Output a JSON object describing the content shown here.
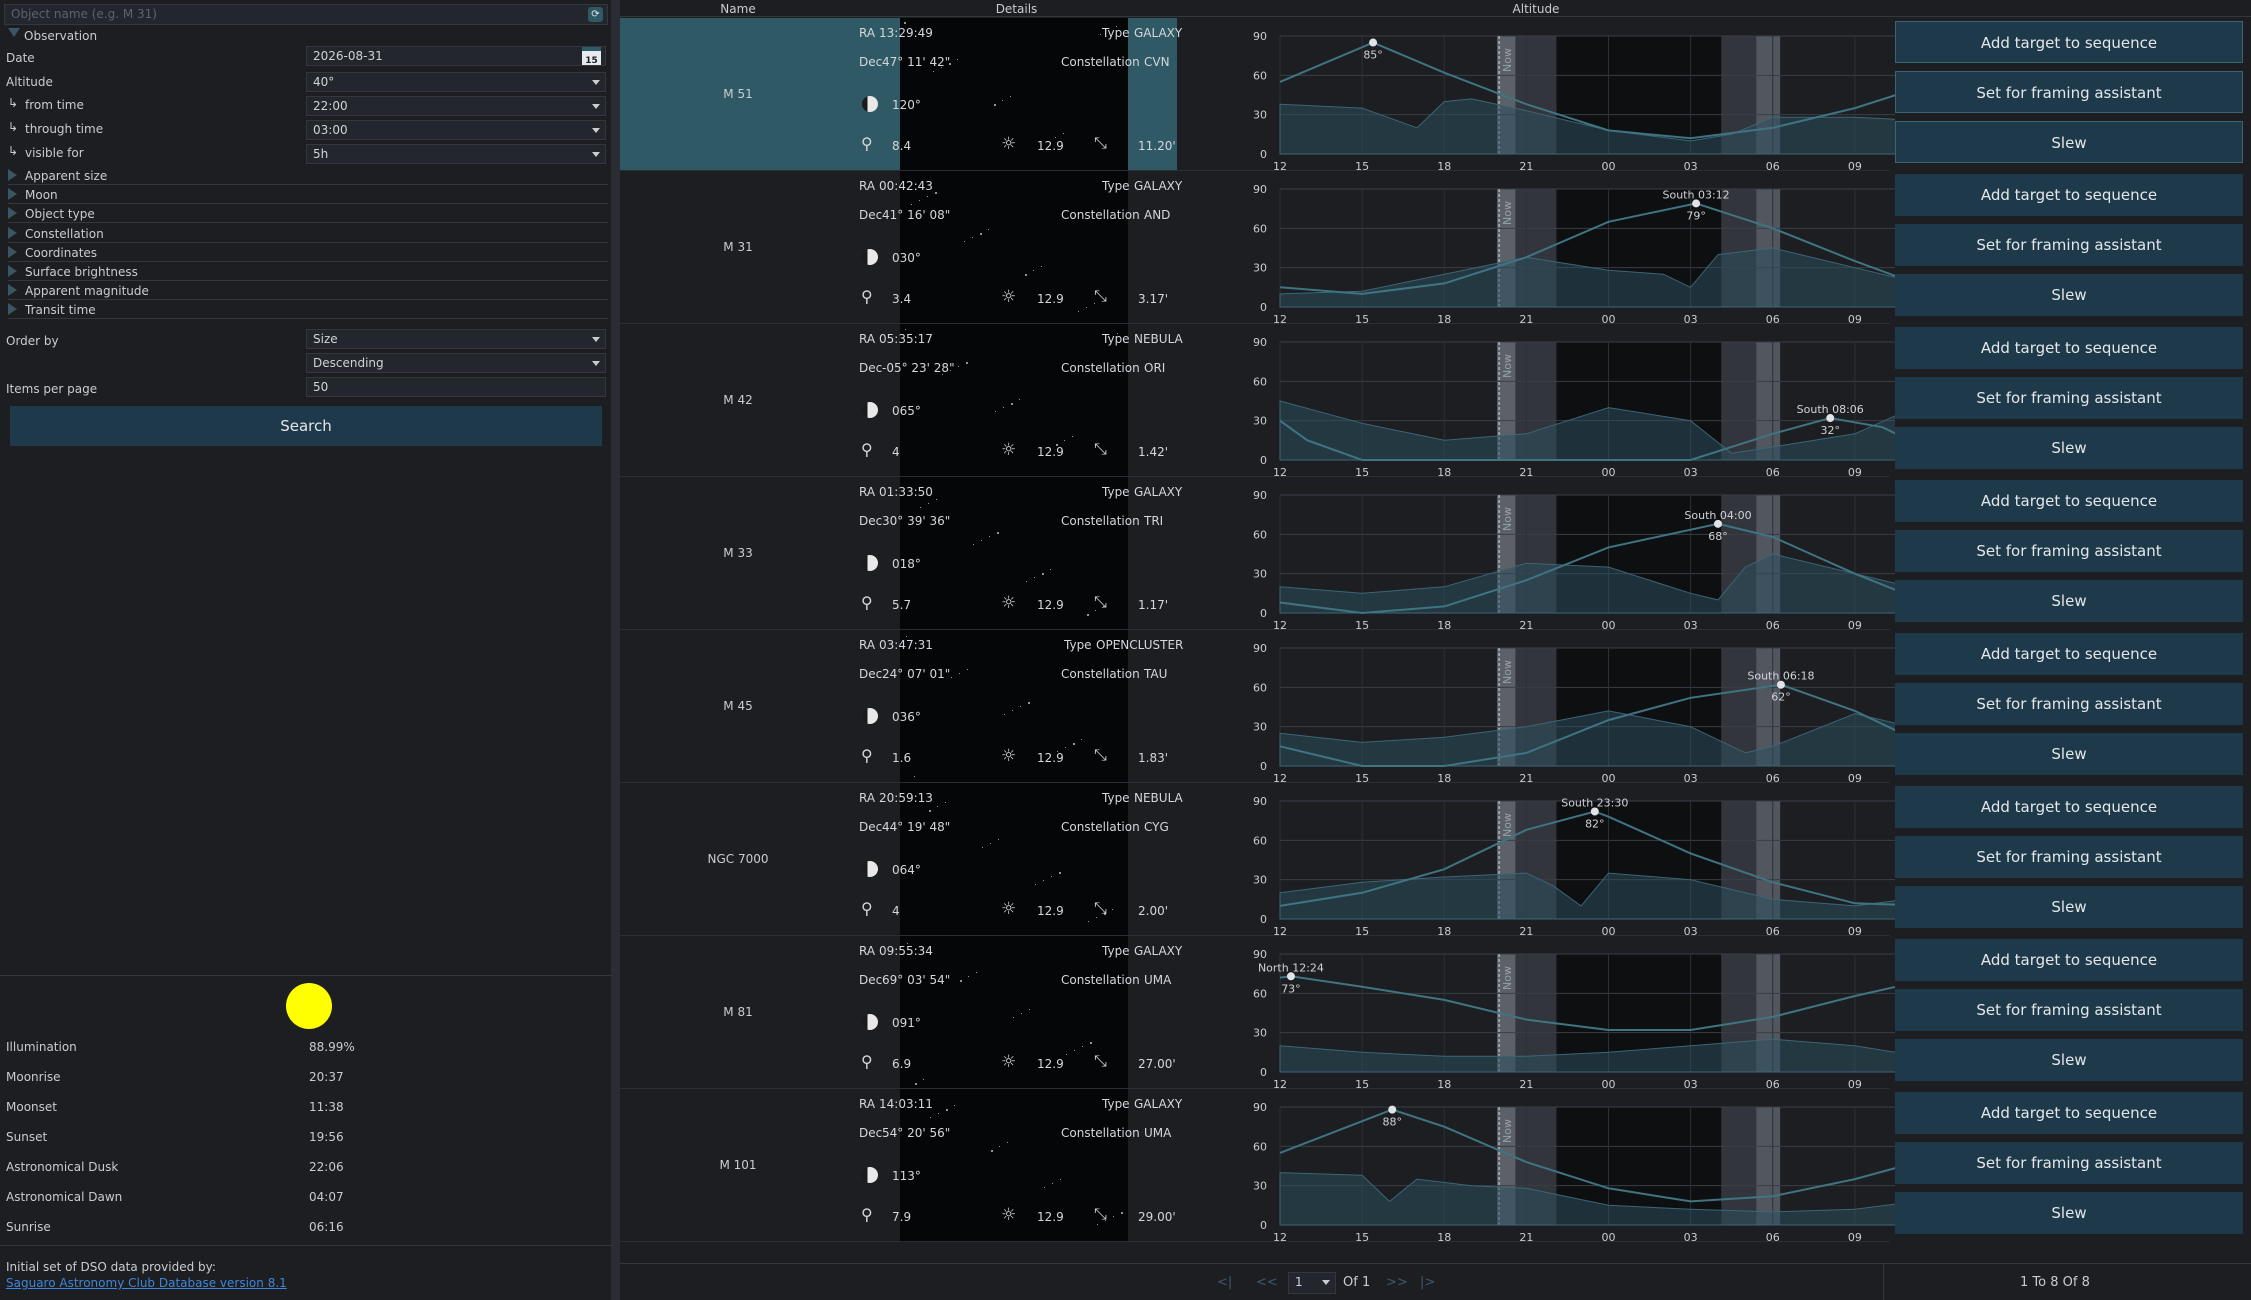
{
  "filters": {
    "object_name_placeholder": "Object name (e.g. M 31)",
    "observation_label": "Observation",
    "date_label": "Date",
    "date_value": "2026-08-31",
    "calendar_day": "15",
    "altitude_label": "Altitude",
    "altitude_value": "40°",
    "from_time_label": "from time",
    "from_time_value": "22:00",
    "through_time_label": "through time",
    "through_time_value": "03:00",
    "visible_for_label": "visible for",
    "visible_for_value": "5h",
    "expanders": [
      "Apparent size",
      "Moon",
      "Object type",
      "Constellation",
      "Coordinates",
      "Surface brightness",
      "Apparent magnitude",
      "Transit time"
    ],
    "order_by_label": "Order by",
    "order_by_value": "Size",
    "order_dir_value": "Descending",
    "items_per_page_label": "Items per page",
    "items_per_page_value": "50",
    "search_label": "Search"
  },
  "moon": {
    "illumination_label": "Illumination",
    "illumination_value": "88.99%",
    "moonrise_label": "Moonrise",
    "moonrise_value": "20:37",
    "moonset_label": "Moonset",
    "moonset_value": "11:38",
    "sunset_label": "Sunset",
    "sunset_value": "19:56",
    "dusk_label": "Astronomical Dusk",
    "dusk_value": "22:06",
    "dawn_label": "Astronomical Dawn",
    "dawn_value": "04:07",
    "sunrise_label": "Sunrise",
    "sunrise_value": "06:16",
    "moon_color": "#ffff00"
  },
  "credit": {
    "line1": "Initial set of DSO data provided by:",
    "link": "Saguaro Astronomy Club Database version 8.1"
  },
  "columns": {
    "name": "Name",
    "details": "Details",
    "altitude": "Altitude"
  },
  "chart_axes": {
    "y_ticks": [
      "90",
      "60",
      "30",
      "0"
    ],
    "x_ticks": [
      "12",
      "15",
      "18",
      "21",
      "00",
      "03",
      "06",
      "09",
      "12"
    ],
    "now_label": "Now"
  },
  "detail_labels": {
    "ra": "RA",
    "dec": "Dec",
    "type": "Type",
    "constellation": "Constellation",
    "sb": "12.9"
  },
  "actions": {
    "add": "Add target to sequence",
    "framing": "Set for framing assistant",
    "slew": "Slew"
  },
  "targets": [
    {
      "name": "M 51",
      "ra": "13:29:49",
      "dec": "47° 11' 42\"",
      "type": "GALAXY",
      "constellation": "CVN",
      "moon_dist": "120°",
      "magnitude": "8.4",
      "size": "11.20'",
      "transit_label": "",
      "transit_alt": "85°",
      "peak_x": 15.4,
      "peak_alt": 85,
      "selected": true,
      "curve": [
        [
          12,
          55
        ],
        [
          15.4,
          85
        ],
        [
          18,
          62
        ],
        [
          21,
          38
        ],
        [
          0,
          18
        ],
        [
          3,
          12
        ],
        [
          6,
          20
        ],
        [
          9,
          35
        ],
        [
          12,
          55
        ]
      ],
      "moon_curve": [
        [
          12,
          38
        ],
        [
          15,
          35
        ],
        [
          17,
          20
        ],
        [
          18,
          40
        ],
        [
          19,
          42
        ],
        [
          21,
          33
        ],
        [
          0,
          18
        ],
        [
          3,
          10
        ],
        [
          4.5,
          15
        ],
        [
          6,
          28
        ],
        [
          9,
          28
        ],
        [
          12,
          25
        ]
      ]
    },
    {
      "name": "M 31",
      "ra": "00:42:43",
      "dec": "41° 16' 08\"",
      "type": "GALAXY",
      "constellation": "AND",
      "moon_dist": "030°",
      "magnitude": "3.4",
      "size": "3.17'",
      "transit_label": "South 03:12",
      "transit_alt": "79°",
      "peak_x": 3.2,
      "peak_alt": 79,
      "selected": false,
      "curve": [
        [
          12,
          15
        ],
        [
          15,
          10
        ],
        [
          18,
          18
        ],
        [
          21,
          38
        ],
        [
          0,
          65
        ],
        [
          3.2,
          79
        ],
        [
          6,
          60
        ],
        [
          9,
          35
        ],
        [
          12,
          12
        ]
      ],
      "moon_curve": [
        [
          12,
          10
        ],
        [
          15,
          12
        ],
        [
          18,
          25
        ],
        [
          21,
          38
        ],
        [
          0,
          28
        ],
        [
          2,
          25
        ],
        [
          3,
          15
        ],
        [
          4,
          40
        ],
        [
          6,
          45
        ],
        [
          9,
          30
        ],
        [
          12,
          15
        ]
      ]
    },
    {
      "name": "M 42",
      "ra": "05:35:17",
      "dec": "-05° 23' 28\"",
      "type": "NEBULA",
      "constellation": "ORI",
      "moon_dist": "065°",
      "magnitude": "4",
      "size": "1.42'",
      "transit_label": "South 08:06",
      "transit_alt": "32°",
      "peak_x": 8.1,
      "peak_alt": 32,
      "selected": false,
      "curve": [
        [
          12,
          30
        ],
        [
          13,
          15
        ],
        [
          15,
          0
        ],
        [
          18,
          0
        ],
        [
          21,
          0
        ],
        [
          0,
          0
        ],
        [
          3,
          0
        ],
        [
          6,
          20
        ],
        [
          8.1,
          32
        ],
        [
          10,
          25
        ],
        [
          12,
          5
        ]
      ],
      "moon_curve": [
        [
          12,
          45
        ],
        [
          15,
          28
        ],
        [
          18,
          15
        ],
        [
          21,
          20
        ],
        [
          0,
          40
        ],
        [
          3,
          30
        ],
        [
          4.5,
          5
        ],
        [
          6,
          10
        ],
        [
          9,
          20
        ],
        [
          12,
          48
        ]
      ]
    },
    {
      "name": "M 33",
      "ra": "01:33:50",
      "dec": "30° 39' 36\"",
      "type": "GALAXY",
      "constellation": "TRI",
      "moon_dist": "018°",
      "magnitude": "5.7",
      "size": "1.17'",
      "transit_label": "South 04:00",
      "transit_alt": "68°",
      "peak_x": 4.0,
      "peak_alt": 68,
      "selected": false,
      "curve": [
        [
          12,
          8
        ],
        [
          15,
          0
        ],
        [
          18,
          5
        ],
        [
          21,
          25
        ],
        [
          0,
          50
        ],
        [
          4,
          68
        ],
        [
          6,
          58
        ],
        [
          9,
          30
        ],
        [
          12,
          5
        ]
      ],
      "moon_curve": [
        [
          12,
          20
        ],
        [
          15,
          15
        ],
        [
          18,
          20
        ],
        [
          21,
          38
        ],
        [
          0,
          35
        ],
        [
          3,
          15
        ],
        [
          4,
          10
        ],
        [
          5,
          35
        ],
        [
          6,
          45
        ],
        [
          9,
          30
        ],
        [
          12,
          15
        ]
      ]
    },
    {
      "name": "M 45",
      "ra": "03:47:31",
      "dec": "24° 07' 01\"",
      "type": "OPENCLUSTER",
      "constellation": "TAU",
      "moon_dist": "036°",
      "magnitude": "1.6",
      "size": "1.83'",
      "transit_label": "South 06:18",
      "transit_alt": "62°",
      "peak_x": 6.3,
      "peak_alt": 62,
      "selected": false,
      "curve": [
        [
          12,
          15
        ],
        [
          15,
          0
        ],
        [
          18,
          0
        ],
        [
          21,
          10
        ],
        [
          0,
          35
        ],
        [
          3,
          52
        ],
        [
          6.3,
          62
        ],
        [
          9,
          42
        ],
        [
          12,
          12
        ]
      ],
      "moon_curve": [
        [
          12,
          25
        ],
        [
          15,
          18
        ],
        [
          18,
          22
        ],
        [
          21,
          30
        ],
        [
          0,
          42
        ],
        [
          3,
          30
        ],
        [
          5,
          10
        ],
        [
          6,
          15
        ],
        [
          9,
          40
        ],
        [
          12,
          25
        ]
      ]
    },
    {
      "name": "NGC 7000",
      "ra": "20:59:13",
      "dec": "44° 19' 48\"",
      "type": "NEBULA",
      "constellation": "CYG",
      "moon_dist": "064°",
      "magnitude": "4",
      "size": "2.00'",
      "transit_label": "South 23:30",
      "transit_alt": "82°",
      "peak_x": 23.5,
      "peak_alt": 82,
      "selected": false,
      "curve": [
        [
          12,
          10
        ],
        [
          15,
          20
        ],
        [
          18,
          38
        ],
        [
          21,
          68
        ],
        [
          23.5,
          82
        ],
        [
          0,
          78
        ],
        [
          3,
          50
        ],
        [
          6,
          28
        ],
        [
          9,
          12
        ],
        [
          12,
          10
        ]
      ],
      "moon_curve": [
        [
          12,
          20
        ],
        [
          15,
          28
        ],
        [
          18,
          32
        ],
        [
          21,
          35
        ],
        [
          22,
          25
        ],
        [
          23,
          10
        ],
        [
          0,
          35
        ],
        [
          3,
          30
        ],
        [
          6,
          15
        ],
        [
          9,
          10
        ],
        [
          12,
          18
        ]
      ]
    },
    {
      "name": "M 81",
      "ra": "09:55:34",
      "dec": "69° 03' 54\"",
      "type": "GALAXY",
      "constellation": "UMA",
      "moon_dist": "091°",
      "magnitude": "6.9",
      "size": "27.00'",
      "transit_label": "North 12:24",
      "transit_alt": "73°",
      "peak_x": 12.4,
      "peak_alt": 73,
      "selected": false,
      "curve": [
        [
          12,
          72
        ],
        [
          12.4,
          73
        ],
        [
          15,
          65
        ],
        [
          18,
          55
        ],
        [
          21,
          40
        ],
        [
          0,
          32
        ],
        [
          3,
          32
        ],
        [
          6,
          42
        ],
        [
          9,
          58
        ],
        [
          12,
          72
        ]
      ],
      "moon_curve": [
        [
          12,
          20
        ],
        [
          15,
          15
        ],
        [
          18,
          12
        ],
        [
          21,
          12
        ],
        [
          0,
          15
        ],
        [
          3,
          20
        ],
        [
          6,
          25
        ],
        [
          9,
          20
        ],
        [
          12,
          10
        ]
      ]
    },
    {
      "name": "M 101",
      "ra": "14:03:11",
      "dec": "54° 20' 56\"",
      "type": "GALAXY",
      "constellation": "UMA",
      "moon_dist": "113°",
      "magnitude": "7.9",
      "size": "29.00'",
      "transit_label": "",
      "transit_alt": "88°",
      "peak_x": 16.1,
      "peak_alt": 88,
      "selected": false,
      "curve": [
        [
          12,
          55
        ],
        [
          16.1,
          88
        ],
        [
          18,
          75
        ],
        [
          21,
          48
        ],
        [
          0,
          28
        ],
        [
          3,
          18
        ],
        [
          6,
          22
        ],
        [
          9,
          35
        ],
        [
          12,
          52
        ]
      ],
      "moon_curve": [
        [
          12,
          40
        ],
        [
          15,
          38
        ],
        [
          16,
          18
        ],
        [
          17,
          35
        ],
        [
          19,
          30
        ],
        [
          21,
          28
        ],
        [
          0,
          15
        ],
        [
          3,
          12
        ],
        [
          6,
          10
        ],
        [
          9,
          12
        ],
        [
          12,
          20
        ]
      ]
    }
  ],
  "pager": {
    "first": "<|",
    "prev": "<<",
    "page": "1",
    "of": "Of 1",
    "next": ">>",
    "last": "|>",
    "summary": "1 To 8 Of 8"
  }
}
